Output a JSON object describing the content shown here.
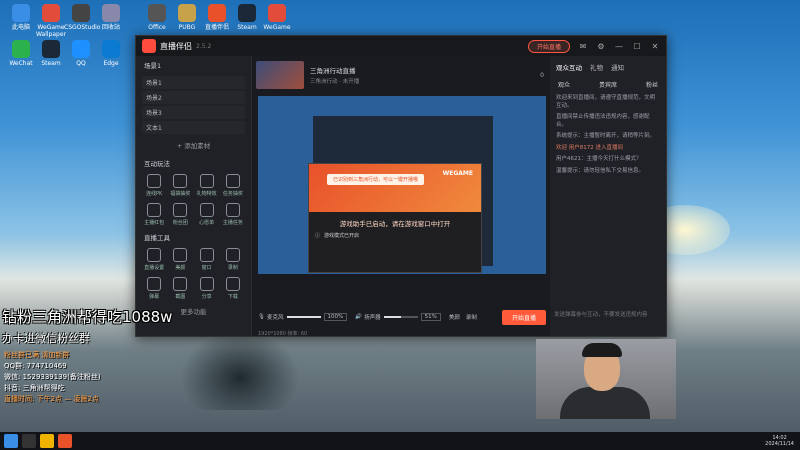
{
  "desktop": {
    "icons": [
      {
        "label": "此电脑",
        "color": "#3a8ee6"
      },
      {
        "label": "WeGame Wallpaper",
        "color": "#e24c3b"
      },
      {
        "label": "CSGOStudio",
        "color": "#444"
      },
      {
        "label": "回收站",
        "color": "#88a"
      },
      {
        "label": "WeChat",
        "color": "#2bb24c"
      },
      {
        "label": "Steam",
        "color": "#1b2838"
      },
      {
        "label": "QQ",
        "color": "#1e90ff"
      },
      {
        "label": "Edge",
        "color": "#0b7ad1"
      }
    ],
    "top_icons": [
      {
        "label": "Office",
        "color": "#555"
      },
      {
        "label": "PUBG",
        "color": "#c8a24a"
      },
      {
        "label": "直播伴侣",
        "color": "#e8512a"
      },
      {
        "label": "Steam",
        "color": "#1b2838"
      },
      {
        "label": "WeGame",
        "color": "#e24c3b"
      }
    ]
  },
  "app": {
    "title": "直播伴侣",
    "version": "2.5.2",
    "start_live_header": "开始直播",
    "left": {
      "scene_header": "场景1",
      "scenes": [
        "场景1",
        "场景2",
        "场景3",
        "文本1"
      ],
      "add_scene": "+ 添加素材",
      "section_interact": "互动玩法",
      "interact_tools": [
        "连线PK",
        "福袋抽奖",
        "礼物特效",
        "任务抽奖",
        "主播红包",
        "粉丝团",
        "心愿单",
        "主播任务"
      ],
      "section_tools": "直播工具",
      "tools": [
        "直播设置",
        "美颜",
        "窗口",
        "录制",
        "弹幕",
        "截图",
        "分享",
        "下载"
      ],
      "more": "更多功能"
    },
    "mid": {
      "stream_title": "三角洲行动直播",
      "stream_sub": "三角洲行动 · 未开播",
      "viewers": "0",
      "preview_dialog_msg": "游戏助手已启动，请在游戏窗口中打开",
      "wegame_label": "WEGAME",
      "dialog_banner": "已识别到三角洲行动，可以一键开播哦",
      "dialog_hint": "游戏模式已开启",
      "volume_label": "麦克风",
      "mic_pct": "100%",
      "speaker_label": "扬声器",
      "speaker_pct": "51%",
      "camera_label": "美颜",
      "record_label": "录制",
      "go_live": "开始直播",
      "resolution": "1920*1080  帧率: 60"
    },
    "right": {
      "tabs": [
        "观众互动",
        "礼物",
        "通知"
      ],
      "sub_tabs": [
        "观众",
        "贵宾席",
        "粉丝"
      ],
      "chat_lines": [
        "欢迎来到直播间，请遵守直播规范，文明互动。",
        "直播间禁止传播违法违规内容，感谢配合。",
        "系统提示：主播暂时离开，请稍等片刻。",
        "欢迎 用户8172 进入直播间",
        "用户4621：主播今天打什么模式？",
        "温馨提示：请勿轻信私下交易信息。"
      ],
      "input_hint": "发送弹幕参与互动，不要发送违规内容"
    }
  },
  "overlay": {
    "line1": "钻粉三角洲帮得吃1088w",
    "line2": "办卡进微信粉丝群",
    "info_lines": [
      "粉丝群已满 请加新群",
      "QQ群: 774710469",
      "微信: 1529339139(备注粉丝)",
      "抖音: 三角洲帮得吃",
      "直播时间: 下午2点 — 凌晨2点"
    ]
  },
  "taskbar": {
    "time": "14:02",
    "date": "2024/11/14"
  }
}
